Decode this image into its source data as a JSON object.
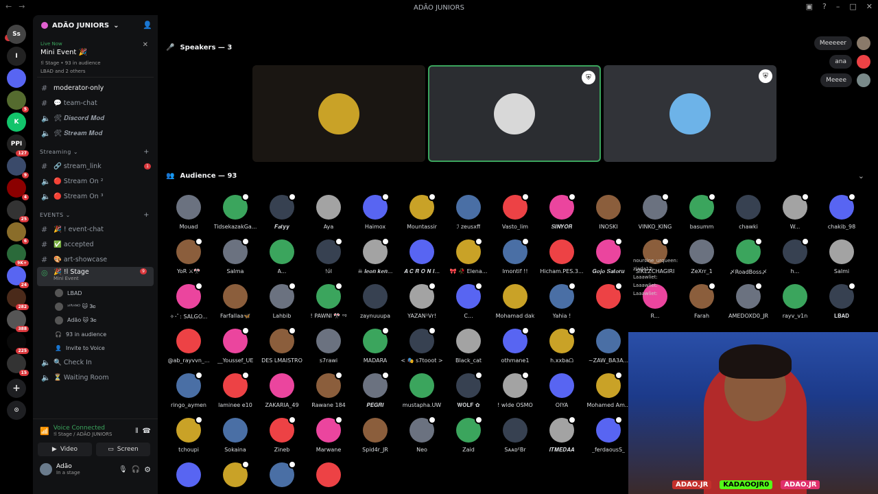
{
  "window": {
    "title": "ADÃO JUNIORS"
  },
  "rail": {
    "new_label": "NEW",
    "servers": [
      {
        "label": "Ss",
        "color": "#444",
        "badge": ""
      },
      {
        "label": "I",
        "color": "#222",
        "badge": ""
      },
      {
        "label": "",
        "color": "#5865f2",
        "badge": ""
      },
      {
        "label": "",
        "color": "#556b2f",
        "badge": "5"
      },
      {
        "label": "K",
        "color": "#12c46b",
        "badge": ""
      },
      {
        "label": "PPI",
        "color": "#222",
        "badge": "127"
      },
      {
        "label": "",
        "color": "#3a4a6a",
        "badge": "9"
      },
      {
        "label": "",
        "color": "#8b0000",
        "badge": "4"
      },
      {
        "label": "",
        "color": "#333",
        "badge": "25"
      },
      {
        "label": "",
        "color": "#8a6d2a",
        "badge": "6"
      },
      {
        "label": "",
        "color": "#2a6a3a",
        "badge": "9K+"
      },
      {
        "label": "",
        "color": "#5865f2",
        "badge": "24"
      },
      {
        "label": "",
        "color": "#4a2a1a",
        "badge": "282"
      },
      {
        "label": "",
        "color": "#555",
        "badge": "388"
      },
      {
        "label": "",
        "color": "#0a0a0a",
        "badge": "225"
      },
      {
        "label": "",
        "color": "#333",
        "badge": "15"
      }
    ]
  },
  "sidebar": {
    "server_name": "ADÃO JUNIORS",
    "live": {
      "tag": "Live Now",
      "title": "Mini Event 🎉",
      "stage_line": "!l Stage  •  93 in audience",
      "names_line": "LBAD and 2 others"
    },
    "channels_top": [
      {
        "icon": "#",
        "label": "moderator-only",
        "bright": true
      },
      {
        "icon": "#",
        "label": "💬 team-chat",
        "bright": false
      },
      {
        "icon": "🔈",
        "label": "🛠 𝑫𝒊𝒔𝒄𝒐𝒓𝒅 𝑴𝒐𝒅",
        "bright": false
      },
      {
        "icon": "🔈",
        "label": "🛠 𝑺𝒕𝒓𝒆𝒂𝒎 𝑴𝒐𝒅",
        "bright": false
      }
    ],
    "streaming_label": "Streaming",
    "channels_streaming": [
      {
        "icon": "#",
        "label": "🔗 stream_link",
        "badge": "1"
      },
      {
        "icon": "🔈",
        "label": "🔴 Stream On ²",
        "badge": ""
      },
      {
        "icon": "🔈",
        "label": "🔴 Stream On ³",
        "badge": ""
      }
    ],
    "events_label": "EVENTS",
    "channels_events": [
      {
        "icon": "#",
        "label": "🎉 ! event-chat"
      },
      {
        "icon": "#",
        "label": "✅ accepted"
      },
      {
        "icon": "#",
        "label": "🎨 art-showcase"
      }
    ],
    "stage": {
      "label": "🎉 !l Stage",
      "sub": "Mini Event",
      "badge": "9"
    },
    "stage_members": [
      "LBAD",
      "ˢᴵᴿᴬᴺᴼ 🐱 𝟑𝐜",
      "Adão 🐱 𝟑𝐜"
    ],
    "audience_line": "93 in audience",
    "invite_label": "Invite to Voice",
    "channels_bottom": [
      {
        "icon": "🔈",
        "label": "🔍 Check In"
      },
      {
        "icon": "🔈",
        "label": "⏳ Waiting Room"
      }
    ],
    "voice": {
      "status": "Voice Connected",
      "sub": "!l Stage / ADÃO JUNIORS",
      "video_label": "Video",
      "screen_label": "Screen"
    },
    "user": {
      "name": "Adão",
      "status": "In a stage"
    }
  },
  "main": {
    "speakers_header": "Speakers — 3",
    "audience_header": "Audience — 93",
    "speakers": [
      {
        "color": "#1a1612",
        "avatar": "#c9a227",
        "mod": false,
        "active": false
      },
      {
        "color": "#2b2d31",
        "avatar": "#d8d8d8",
        "mod": true,
        "active": true
      },
      {
        "color": "#313338",
        "avatar": "#6db3e8",
        "mod": true,
        "active": false
      }
    ],
    "chips": [
      "Meeeeer",
      "ana",
      "Meeee"
    ],
    "audience": [
      [
        "Mouad",
        "TidsekazakGa...",
        "𝑭𝒂𝒕𝒚𝒚",
        "Aya",
        "Haimox",
        "Mountassir",
        "ℐ zeusxff",
        "Vasto_lim",
        "𝑺𝑰𝑵𝒀𝑶𝑹",
        "INOSKI",
        "VINKO_KING",
        "basumm",
        "chawki",
        "W...",
        "chakib_98"
      ],
      [
        "YoR ⚔🎌",
        "Salma",
        "A...",
        "!ύl",
        "☠ 𝒍𝒆𝒐𝒏 𝒌𝒆𝒏...",
        "𝑨 𝑪 𝑹 𝑶 𝑵 𝑰...",
        "🎀 🥀 Elena...",
        "lmontif !!",
        "Hicham.PES.3...",
        "𝑮𝒐𝒋𝒐 𝑺𝒂𝒕𝒐𝒓𝒖",
        "SIKEZCHAGIRI",
        "ZeXrr_1",
        "〆RoadBoss〆",
        "h...",
        "Salmi"
      ],
      [
        "✧･ﾟ: SALGO...",
        "Farfallaa🦋",
        "Lahbib",
        "! PAWNI 🎌 ᵒᵍ",
        "zaynuuupa",
        "YAZAN¹Vr!",
        "C...",
        "Mohamad dak",
        "Yahia !",
        "",
        "R...",
        "Farah",
        "AMEDOXD0_JR",
        "rayv_v1n",
        "𝐋𝐁𝐀𝐃"
      ],
      [
        "@ab_rayvvn_...",
        "__Youssef_UE",
        "DES LMAISTRO",
        "s7rawi",
        "MADARA",
        "< 🎭 s7tooot >",
        "Black_cat",
        "othmane1",
        "h.xxbaᗝ",
        "~ZAW_BA3A..."
      ],
      [
        "ringo_aymen",
        "laminee e10",
        "ZAKARIA_49",
        "Rawane 184",
        "𝑷𝑬𝑮𝑹𝑰",
        "mustapha.UW",
        "𝐖𝐎𝐋𝐅 ✿",
        "! wlde OSMO",
        "OIYA",
        "Mohamed Am..."
      ],
      [
        "tchoupi",
        "Sokaina",
        "Zineb",
        "Marwane",
        "Spid4r_JR",
        "Neo",
        "Zaid",
        "SᴀᴀᴅᴱBr",
        "𝑰𝑻𝑴𝑬𝑫𝑨𝑨",
        "_ferdaousS_"
      ],
      [
        "",
        "",
        "",
        ""
      ]
    ],
    "chat_overlay": [
      "noursine_urqueen:",
      "ziada12:",
      "Laaawliet:",
      "Laaawliet:",
      "Laaawliet:"
    ],
    "socials": [
      "ADAO.JR",
      "KADAOOJR0",
      "ADAO.JR"
    ]
  }
}
